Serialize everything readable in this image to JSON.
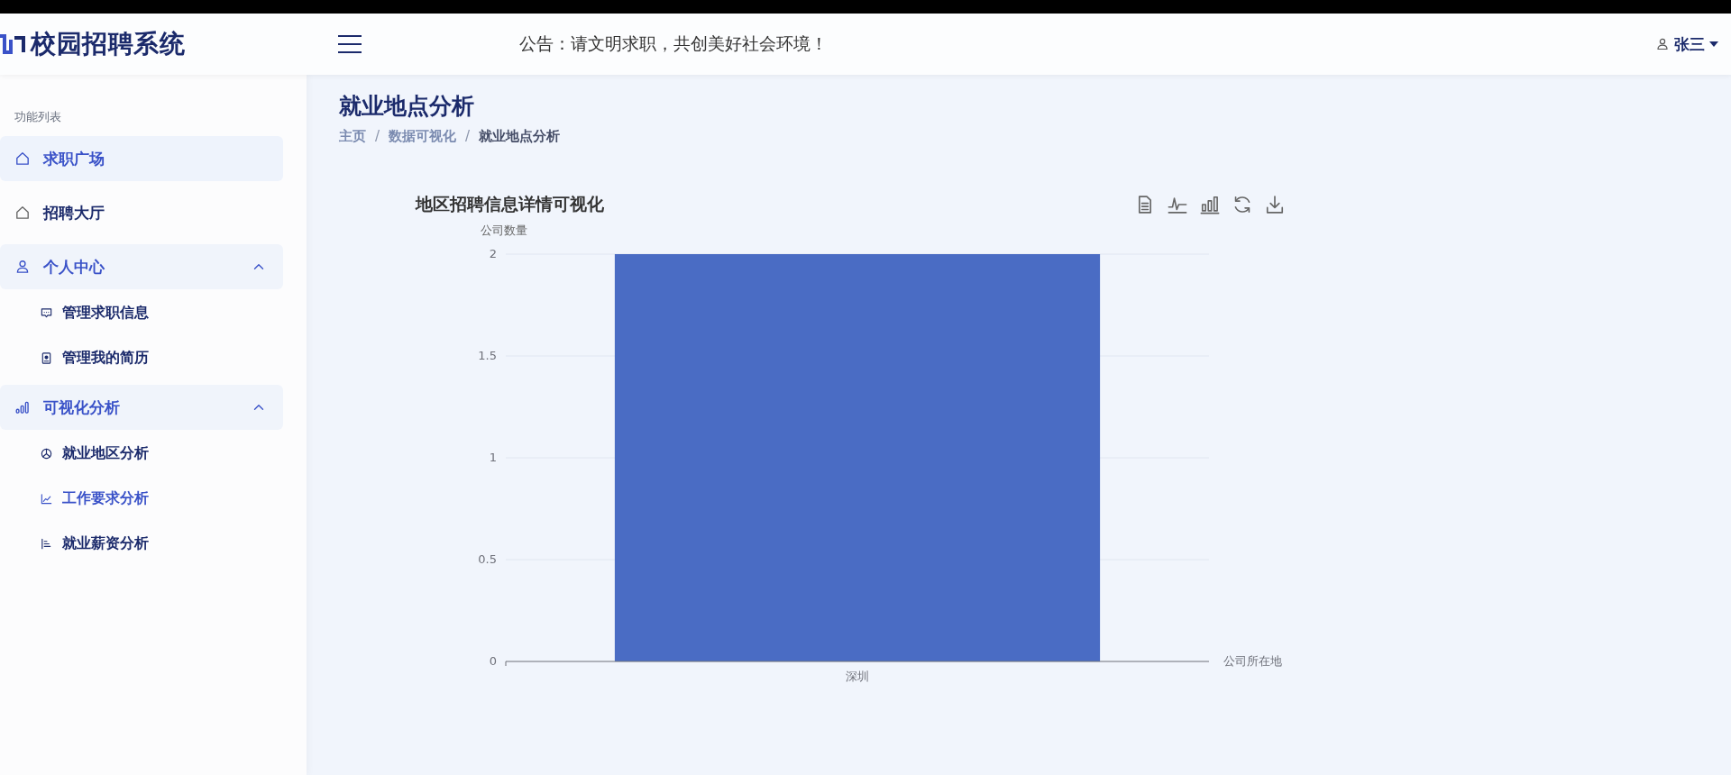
{
  "header": {
    "app_title": "校园招聘系统",
    "notice": "公告：请文明求职，共创美好社会环境！",
    "user": "张三"
  },
  "sidebar": {
    "heading": "功能列表",
    "items": [
      {
        "label": "求职广场",
        "kind": "link",
        "selected": true
      },
      {
        "label": "招聘大厅",
        "kind": "link",
        "selected": false
      },
      {
        "label": "个人中心",
        "kind": "group",
        "expanded": true,
        "children": [
          {
            "label": "管理求职信息",
            "selected": false,
            "highlighted": false
          },
          {
            "label": "管理我的简历",
            "selected": false,
            "highlighted": false
          }
        ]
      },
      {
        "label": "可视化分析",
        "kind": "group",
        "expanded": true,
        "children": [
          {
            "label": "就业地区分析",
            "selected": false,
            "highlighted": false
          },
          {
            "label": "工作要求分析",
            "selected": false,
            "highlighted": true
          },
          {
            "label": "就业薪资分析",
            "selected": false,
            "highlighted": false
          }
        ]
      }
    ]
  },
  "page": {
    "title": "就业地点分析",
    "breadcrumb_separator": "/",
    "breadcrumb": [
      {
        "label": "主页",
        "current": false
      },
      {
        "label": "数据可视化",
        "current": false
      },
      {
        "label": "就业地点分析",
        "current": true
      }
    ]
  },
  "chart": {
    "chart_data": {
      "type": "bar",
      "title": "地区招聘信息详情可视化",
      "xlabel": "公司所在地",
      "ylabel": "公司数量",
      "categories": [
        "深圳"
      ],
      "series": [
        {
          "color": "#4a6cc4",
          "values": [
            2
          ]
        }
      ],
      "ylim": [
        0,
        2
      ],
      "yticks": [
        0,
        0.5,
        1,
        1.5,
        2
      ],
      "grid": true
    }
  }
}
